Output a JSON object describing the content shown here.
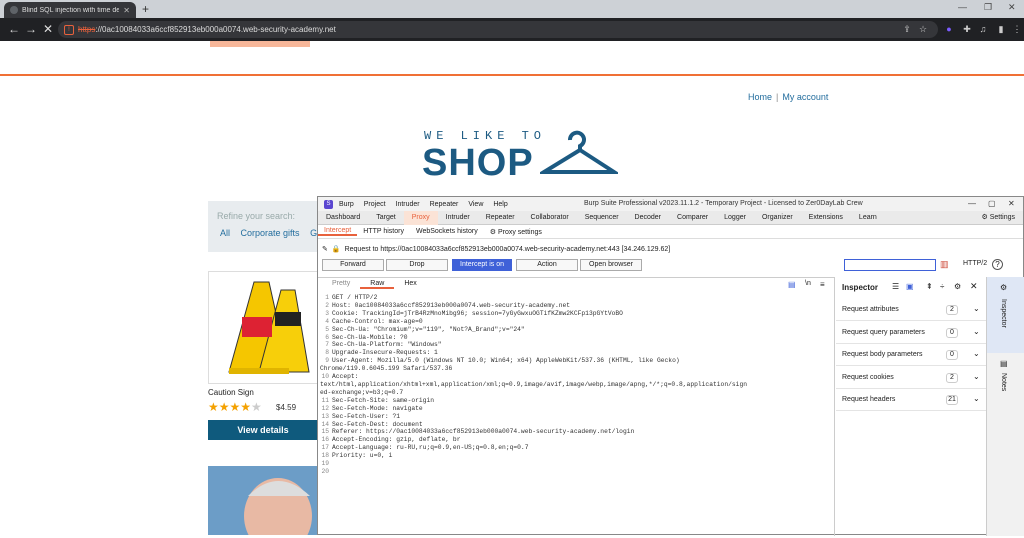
{
  "browser": {
    "tab_title": "Blind SQL injection with time de",
    "url_protocol": "https",
    "url_rest": "://0ac10084033a6ccf852913eb000a0074.web-security-academy.net"
  },
  "site": {
    "nav_home": "Home",
    "nav_sep": "|",
    "nav_account": "My account",
    "logo_top": "WE LIKE TO",
    "logo_main": "SHOP",
    "refine": "Refine your search:",
    "categories": [
      "All",
      "Corporate gifts",
      "Gif"
    ],
    "product_name": "Caution Sign",
    "product_price": "$4.59",
    "rating_stars": 4,
    "view_details": "View details"
  },
  "burp": {
    "menu": [
      "Burp",
      "Project",
      "Intruder",
      "Repeater",
      "View",
      "Help"
    ],
    "title": "Burp Suite Professional v2023.11.1.2 - Temporary Project - Licensed to Zer0DayLab Crew",
    "tabs": [
      "Dashboard",
      "Target",
      "Proxy",
      "Intruder",
      "Repeater",
      "Collaborator",
      "Sequencer",
      "Decoder",
      "Comparer",
      "Logger",
      "Organizer",
      "Extensions",
      "Learn"
    ],
    "settings": "Settings",
    "subtabs": [
      "Intercept",
      "HTTP history",
      "WebSockets history"
    ],
    "proxy_settings": "Proxy settings",
    "request_to": "Request to https://0ac10084033a6ccf852913eb000a0074.web-security-academy.net:443  [34.246.129.62]",
    "actions": [
      "Forward",
      "Drop",
      "Intercept is on",
      "Action",
      "Open browser"
    ],
    "http_version": "HTTP/2",
    "editor_tabs": [
      "Pretty",
      "Raw",
      "Hex"
    ],
    "code_lines": [
      "GET / HTTP/2",
      "Host: 0ac10084033a6ccf852913eb000a0074.web-security-academy.net",
      "Cookie: TrackingId=jTrB4RzMnoMibg96; session=7yGyGwxuOGTifKZmw2KCFp13pGYtVoBO",
      "Cache-Control: max-age=0",
      "Sec-Ch-Ua: \"Chromium\";v=\"119\", \"Not?A_Brand\";v=\"24\"",
      "Sec-Ch-Ua-Mobile: ?0",
      "Sec-Ch-Ua-Platform: \"Windows\"",
      "Upgrade-Insecure-Requests: 1",
      "User-Agent: Mozilla/5.0 (Windows NT 10.0; Win64; x64) AppleWebKit/537.36 (KHTML, like Gecko)\nChrome/119.0.6045.199 Safari/537.36",
      "Accept:\ntext/html,application/xhtml+xml,application/xml;q=0.9,image/avif,image/webp,image/apng,*/*;q=0.8,application/sign\ned-exchange;v=b3;q=0.7",
      "Sec-Fetch-Site: same-origin",
      "Sec-Fetch-Mode: navigate",
      "Sec-Fetch-User: ?1",
      "Sec-Fetch-Dest: document",
      "Referer: https://0ac10084033a6ccf852913eb000a0074.web-security-academy.net/login",
      "Accept-Encoding: gzip, deflate, br",
      "Accept-Language: ru-RU,ru;q=0.9,en-US;q=0.8,en;q=0.7",
      "Priority: u=0, i",
      "",
      ""
    ],
    "inspector_title": "Inspector",
    "inspector_rows": [
      {
        "label": "Request attributes",
        "count": "2"
      },
      {
        "label": "Request query parameters",
        "count": "0"
      },
      {
        "label": "Request body parameters",
        "count": "0"
      },
      {
        "label": "Request cookies",
        "count": "2"
      },
      {
        "label": "Request headers",
        "count": "21"
      }
    ],
    "side_tabs": [
      "Inspector",
      "Notes"
    ]
  }
}
